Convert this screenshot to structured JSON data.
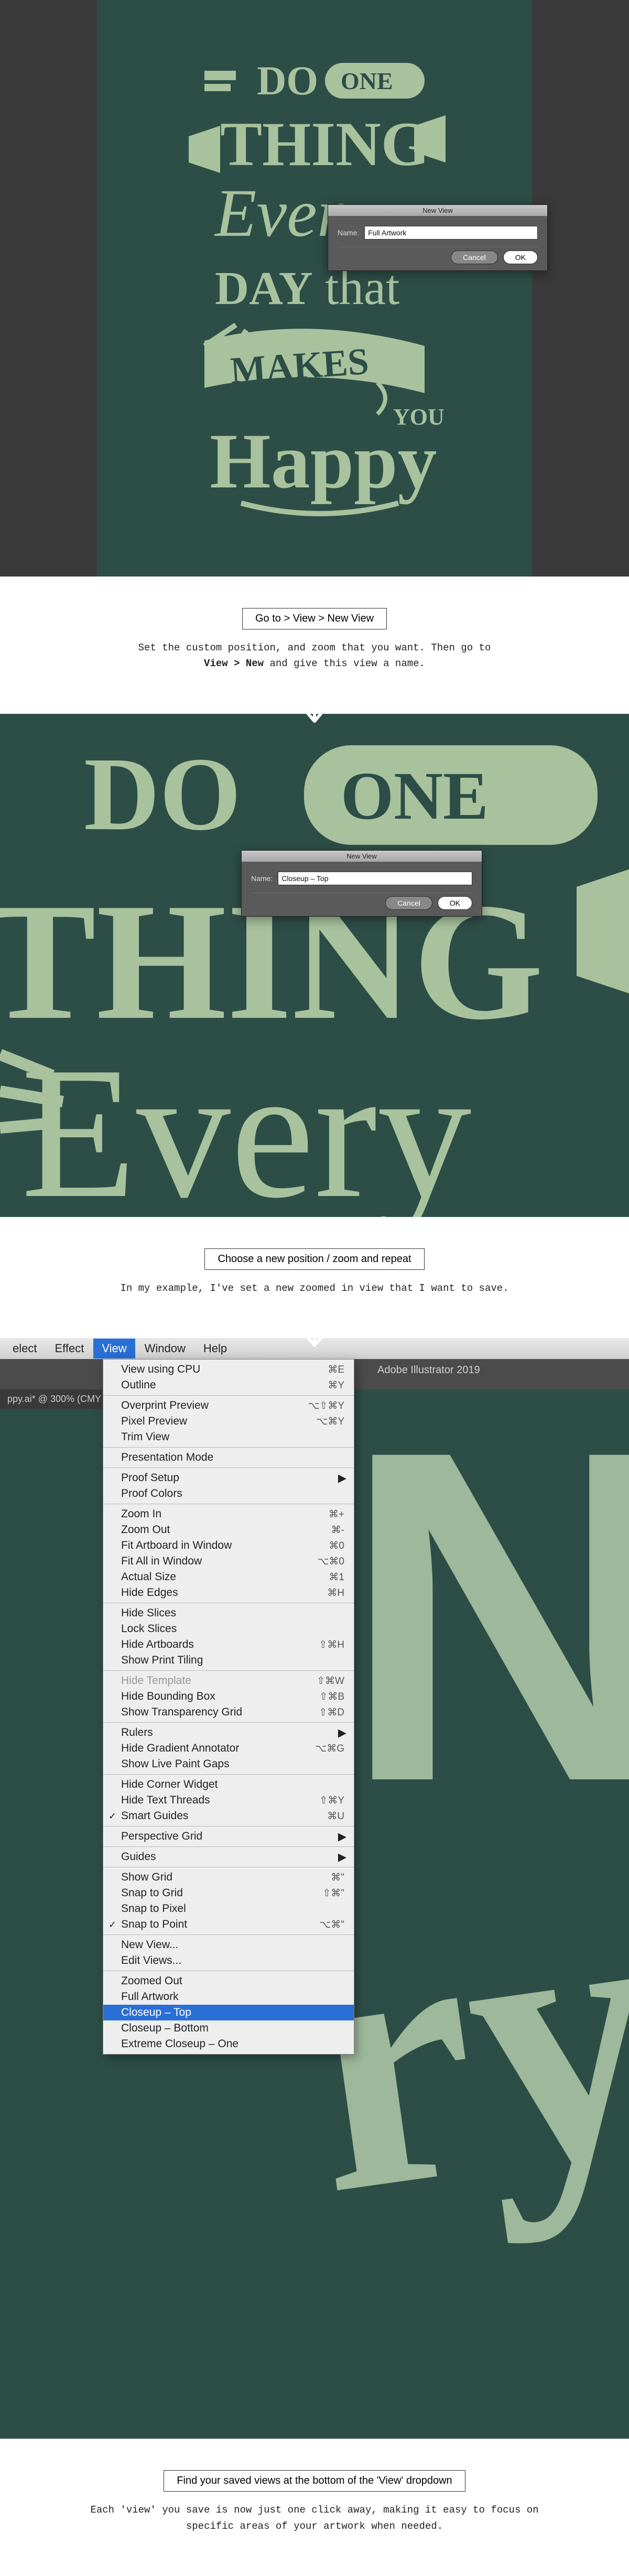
{
  "section1": {
    "dialog_title": "New View",
    "name_label": "Name:",
    "name_value": "Full Artwork",
    "cancel": "Cancel",
    "ok": "OK",
    "caption_title": "Go to > View > New View",
    "caption_line1": "Set the custom position, and zoom that you want. Then go to",
    "caption_line2a": "View > New",
    "caption_line2b": " and give this view a name."
  },
  "section2": {
    "dialog_title": "New View",
    "name_label": "Name:",
    "name_value": "Closeup – Top",
    "cancel": "Cancel",
    "ok": "OK",
    "caption_title": "Choose a new position / zoom and repeat",
    "caption_line": "In my example, I've set a new zoomed in view that I want to save."
  },
  "section3": {
    "menubar": [
      "elect",
      "Effect",
      "View",
      "Window",
      "Help"
    ],
    "app_title": "Adobe Illustrator 2019",
    "doc_tab": "ppy.ai* @ 300% (CMY",
    "menu_groups": [
      [
        {
          "label": "View using CPU",
          "shortcut": "⌘E"
        },
        {
          "label": "Outline",
          "shortcut": "⌘Y"
        }
      ],
      [
        {
          "label": "Overprint Preview",
          "shortcut": "⌥⇧⌘Y"
        },
        {
          "label": "Pixel Preview",
          "shortcut": "⌥⌘Y"
        },
        {
          "label": "Trim View"
        }
      ],
      [
        {
          "label": "Presentation Mode"
        }
      ],
      [
        {
          "label": "Proof Setup",
          "submenu": true
        },
        {
          "label": "Proof Colors"
        }
      ],
      [
        {
          "label": "Zoom In",
          "shortcut": "⌘+"
        },
        {
          "label": "Zoom Out",
          "shortcut": "⌘-"
        },
        {
          "label": "Fit Artboard in Window",
          "shortcut": "⌘0"
        },
        {
          "label": "Fit All in Window",
          "shortcut": "⌥⌘0"
        },
        {
          "label": "Actual Size",
          "shortcut": "⌘1"
        },
        {
          "label": "Hide Edges",
          "shortcut": "⌘H"
        }
      ],
      [
        {
          "label": "Hide Slices"
        },
        {
          "label": "Lock Slices"
        },
        {
          "label": "Hide Artboards",
          "shortcut": "⇧⌘H"
        },
        {
          "label": "Show Print Tiling"
        }
      ],
      [
        {
          "label": "Hide Template",
          "shortcut": "⇧⌘W",
          "disabled": true
        },
        {
          "label": "Hide Bounding Box",
          "shortcut": "⇧⌘B"
        },
        {
          "label": "Show Transparency Grid",
          "shortcut": "⇧⌘D"
        }
      ],
      [
        {
          "label": "Rulers",
          "shortcut": "",
          "submenu": true
        },
        {
          "label": "Hide Gradient Annotator",
          "shortcut": "⌥⌘G"
        },
        {
          "label": "Show Live Paint Gaps"
        }
      ],
      [
        {
          "label": "Hide Corner Widget"
        },
        {
          "label": "Hide Text Threads",
          "shortcut": "⇧⌘Y"
        },
        {
          "label": "Smart Guides",
          "shortcut": "⌘U",
          "checked": true
        }
      ],
      [
        {
          "label": "Perspective Grid",
          "submenu": true
        }
      ],
      [
        {
          "label": "Guides",
          "submenu": true
        }
      ],
      [
        {
          "label": "Show Grid",
          "shortcut": "⌘\""
        },
        {
          "label": "Snap to Grid",
          "shortcut": "⇧⌘\""
        },
        {
          "label": "Snap to Pixel"
        },
        {
          "label": "Snap to Point",
          "shortcut": "⌥⌘\"",
          "checked": true
        }
      ],
      [
        {
          "label": "New View..."
        },
        {
          "label": "Edit Views..."
        }
      ],
      [
        {
          "label": "Zoomed Out"
        },
        {
          "label": "Full Artwork"
        },
        {
          "label": "Closeup – Top",
          "selected": true
        },
        {
          "label": "Closeup – Bottom"
        },
        {
          "label": "Extreme Closeup – One"
        }
      ]
    ],
    "caption_title": "Find your saved views at the bottom of the 'View' dropdown",
    "caption_line": "Each 'view' you save is now just one click away, making it easy to focus on specific areas of your artwork when needed."
  }
}
